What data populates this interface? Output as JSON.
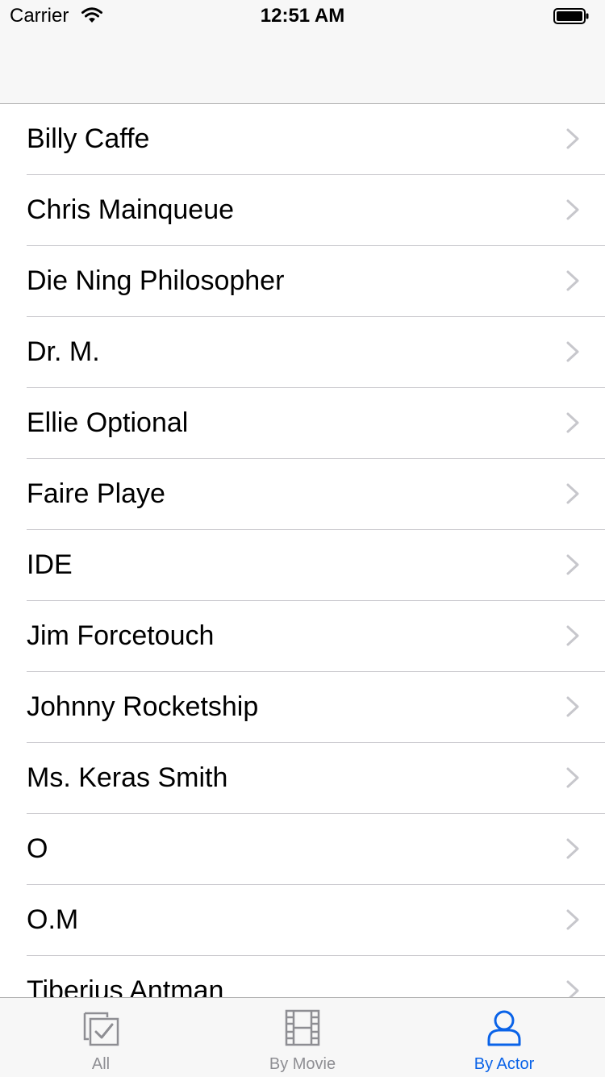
{
  "status_bar": {
    "carrier": "Carrier",
    "time": "12:51 AM",
    "icons": [
      "wifi-icon",
      "battery-icon"
    ]
  },
  "actors": [
    {
      "name": "Billy Caffe"
    },
    {
      "name": "Chris Mainqueue"
    },
    {
      "name": "Die Ning Philosopher"
    },
    {
      "name": "Dr. M."
    },
    {
      "name": "Ellie Optional"
    },
    {
      "name": "Faire Playe"
    },
    {
      "name": "IDE"
    },
    {
      "name": "Jim Forcetouch"
    },
    {
      "name": "Johnny Rocketship"
    },
    {
      "name": "Ms. Keras Smith"
    },
    {
      "name": "O"
    },
    {
      "name": "O.M"
    },
    {
      "name": "Tiberius Antman"
    }
  ],
  "tabs": [
    {
      "label": "All",
      "icon": "checklist-icon",
      "selected": false
    },
    {
      "label": "By Movie",
      "icon": "film-icon",
      "selected": false
    },
    {
      "label": "By Actor",
      "icon": "person-icon",
      "selected": true
    }
  ],
  "colors": {
    "accent": "#0a63e8",
    "inactive": "#8e8e93",
    "separator": "#c8c7cc",
    "bar_background": "#f7f7f7"
  }
}
